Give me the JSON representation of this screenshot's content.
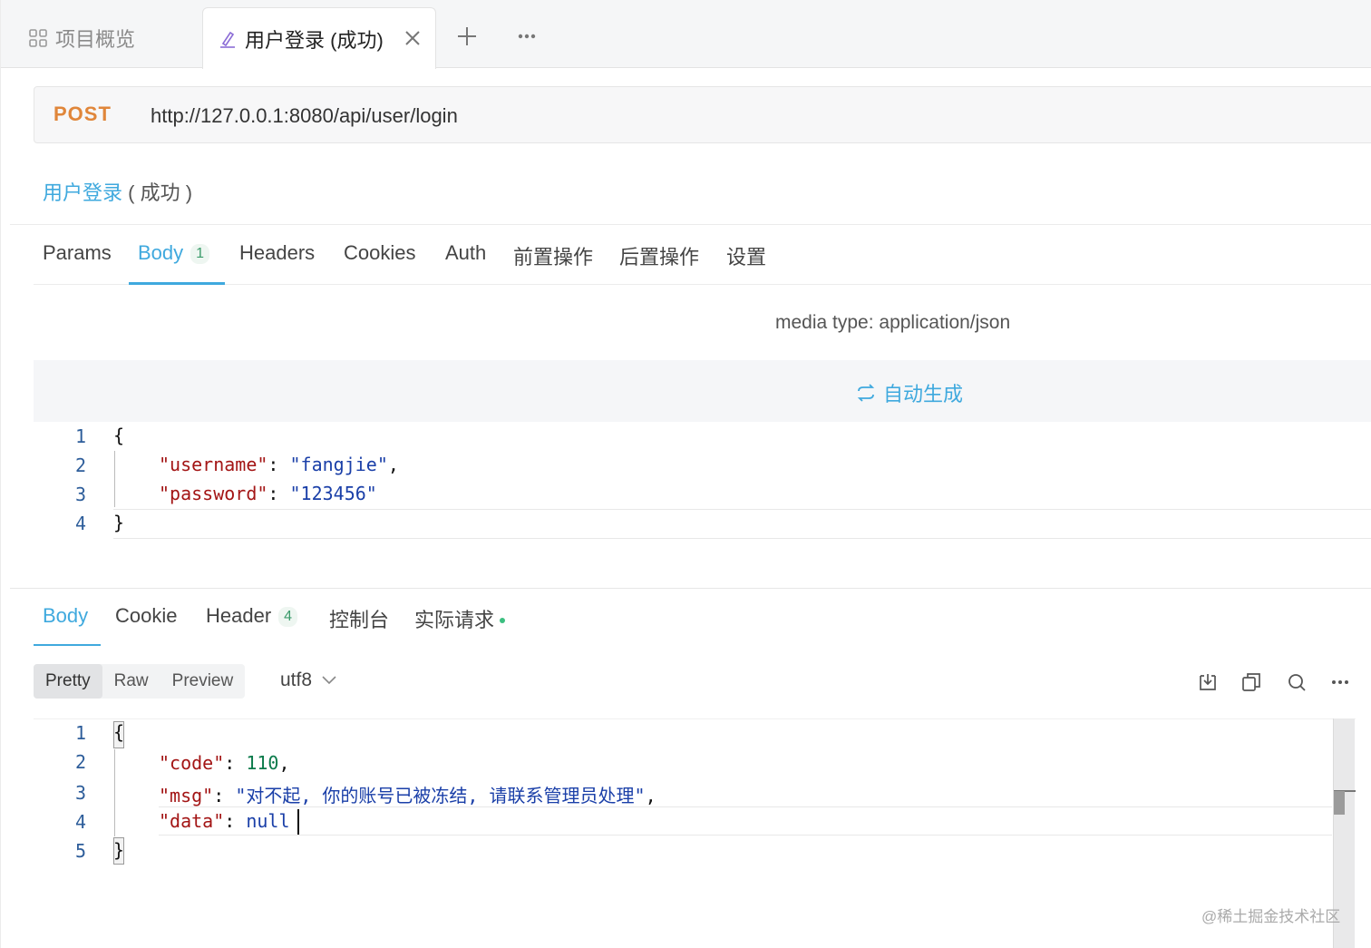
{
  "tabs": {
    "overview_label": "项目概览",
    "active_label": "用户登录 (成功)"
  },
  "request": {
    "method": "POST",
    "url": "http://127.0.0.1:8080/api/user/login",
    "title_link": "用户登录",
    "title_rest": "( 成功 )"
  },
  "request_tabs": [
    {
      "label": "Params"
    },
    {
      "label": "Body",
      "badge": "1"
    },
    {
      "label": "Headers"
    },
    {
      "label": "Cookies"
    },
    {
      "label": "Auth"
    },
    {
      "label": "前置操作"
    },
    {
      "label": "后置操作"
    },
    {
      "label": "设置"
    }
  ],
  "body": {
    "media_type": "media type: application/json",
    "auto_generate": "自动生成",
    "line_numbers": [
      "1",
      "2",
      "3",
      "4"
    ],
    "lines": {
      "open": "{",
      "username_key": "\"username\"",
      "username_val": "\"fangjie\"",
      "password_key": "\"password\"",
      "password_val": "\"123456\"",
      "close": "}"
    }
  },
  "response_tabs": [
    {
      "label": "Body"
    },
    {
      "label": "Cookie"
    },
    {
      "label": "Header",
      "badge": "4"
    },
    {
      "label": "控制台"
    },
    {
      "label": "实际请求"
    }
  ],
  "view_modes": [
    "Pretty",
    "Raw",
    "Preview"
  ],
  "encoding": "utf8",
  "response": {
    "line_numbers": [
      "1",
      "2",
      "3",
      "4",
      "5"
    ],
    "open": "{",
    "code_key": "\"code\"",
    "code_val": "110",
    "msg_key": "\"msg\"",
    "msg_val": "\"对不起, 你的账号已被冻结, 请联系管理员处理\"",
    "data_key": "\"data\"",
    "data_val": "null",
    "close": "}"
  },
  "watermark": "@稀土掘金技术社区",
  "colors": {
    "accent": "#3fa9de",
    "method": "#e0863a",
    "key": "#a31515",
    "string": "#1a3fa8",
    "number": "#0a7a4a"
  }
}
